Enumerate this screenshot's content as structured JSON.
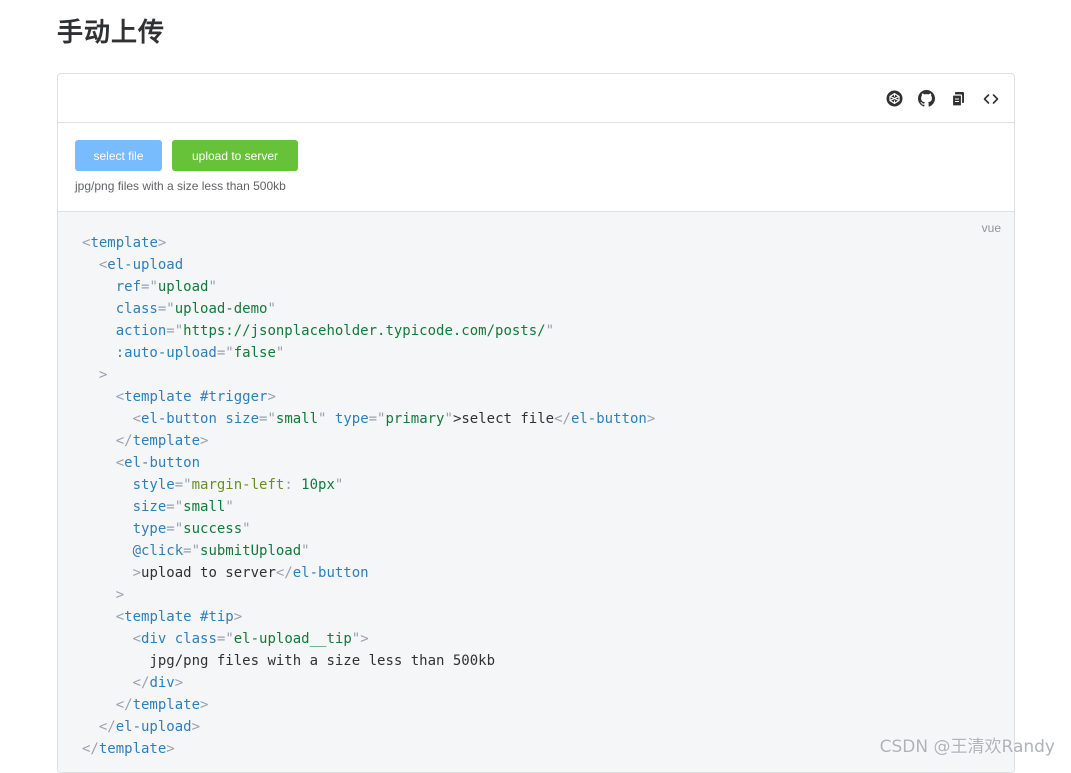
{
  "page": {
    "title": "手动上传"
  },
  "toolbar": {
    "icons": [
      {
        "name": "codepen-icon"
      },
      {
        "name": "github-icon"
      },
      {
        "name": "copy-icon"
      },
      {
        "name": "code-toggle-icon"
      }
    ]
  },
  "demo": {
    "select_button": "select file",
    "upload_button": "upload to server",
    "tip": "jpg/png files with a size less than 500kb",
    "colors": {
      "primary": "#79bbff",
      "success": "#67c23a"
    }
  },
  "code": {
    "language": "vue",
    "lines": [
      [
        [
          "p",
          "<"
        ],
        [
          "g",
          "template"
        ],
        [
          "p",
          ">"
        ]
      ],
      [
        [
          "w",
          "  "
        ],
        [
          "p",
          "<"
        ],
        [
          "g",
          "el-upload"
        ]
      ],
      [
        [
          "w",
          "    "
        ],
        [
          "a",
          "ref"
        ],
        [
          "p",
          "=\""
        ],
        [
          "s",
          "upload"
        ],
        [
          "p",
          "\""
        ]
      ],
      [
        [
          "w",
          "    "
        ],
        [
          "a",
          "class"
        ],
        [
          "p",
          "=\""
        ],
        [
          "s",
          "upload-demo"
        ],
        [
          "p",
          "\""
        ]
      ],
      [
        [
          "w",
          "    "
        ],
        [
          "a",
          "action"
        ],
        [
          "p",
          "=\""
        ],
        [
          "s",
          "https://jsonplaceholder.typicode.com/posts/"
        ],
        [
          "p",
          "\""
        ]
      ],
      [
        [
          "w",
          "    "
        ],
        [
          "a",
          ":auto-upload"
        ],
        [
          "p",
          "=\""
        ],
        [
          "s",
          "false"
        ],
        [
          "p",
          "\""
        ]
      ],
      [
        [
          "w",
          "  "
        ],
        [
          "p",
          ">"
        ]
      ],
      [
        [
          "w",
          "    "
        ],
        [
          "p",
          "<"
        ],
        [
          "g",
          "template #trigger"
        ],
        [
          "p",
          ">"
        ]
      ],
      [
        [
          "w",
          "      "
        ],
        [
          "p",
          "<"
        ],
        [
          "g",
          "el-button "
        ],
        [
          "a",
          "size"
        ],
        [
          "p",
          "=\""
        ],
        [
          "s",
          "small"
        ],
        [
          "p",
          "\" "
        ],
        [
          "a",
          "type"
        ],
        [
          "p",
          "=\""
        ],
        [
          "s",
          "primary"
        ],
        [
          "p",
          "\""
        ],
        [
          "t",
          ">select file"
        ],
        [
          "p",
          "</"
        ],
        [
          "g",
          "el-button"
        ],
        [
          "p",
          ">"
        ]
      ],
      [
        [
          "w",
          "    "
        ],
        [
          "p",
          "</"
        ],
        [
          "g",
          "template"
        ],
        [
          "p",
          ">"
        ]
      ],
      [
        [
          "w",
          "    "
        ],
        [
          "p",
          "<"
        ],
        [
          "g",
          "el-button"
        ]
      ],
      [
        [
          "w",
          "      "
        ],
        [
          "a",
          "style"
        ],
        [
          "p",
          "=\""
        ],
        [
          "c",
          "margin-left"
        ],
        [
          "p",
          ": "
        ],
        [
          "s",
          "10px"
        ],
        [
          "p",
          "\""
        ]
      ],
      [
        [
          "w",
          "      "
        ],
        [
          "a",
          "size"
        ],
        [
          "p",
          "=\""
        ],
        [
          "s",
          "small"
        ],
        [
          "p",
          "\""
        ]
      ],
      [
        [
          "w",
          "      "
        ],
        [
          "a",
          "type"
        ],
        [
          "p",
          "=\""
        ],
        [
          "s",
          "success"
        ],
        [
          "p",
          "\""
        ]
      ],
      [
        [
          "w",
          "      "
        ],
        [
          "a",
          "@click"
        ],
        [
          "p",
          "=\""
        ],
        [
          "s",
          "submitUpload"
        ],
        [
          "p",
          "\""
        ]
      ],
      [
        [
          "w",
          "      "
        ],
        [
          "p",
          ">"
        ],
        [
          "t",
          "upload to server"
        ],
        [
          "p",
          "</"
        ],
        [
          "g",
          "el-button"
        ]
      ],
      [
        [
          "w",
          "    "
        ],
        [
          "p",
          ">"
        ]
      ],
      [
        [
          "w",
          "    "
        ],
        [
          "p",
          "<"
        ],
        [
          "g",
          "template #tip"
        ],
        [
          "p",
          ">"
        ]
      ],
      [
        [
          "w",
          "      "
        ],
        [
          "p",
          "<"
        ],
        [
          "g",
          "div "
        ],
        [
          "a",
          "class"
        ],
        [
          "p",
          "=\""
        ],
        [
          "s",
          "el-upload__tip"
        ],
        [
          "p",
          "\">"
        ]
      ],
      [
        [
          "w",
          "        "
        ],
        [
          "t",
          "jpg/png files with a size less than 500kb"
        ]
      ],
      [
        [
          "w",
          "      "
        ],
        [
          "p",
          "</"
        ],
        [
          "g",
          "div"
        ],
        [
          "p",
          ">"
        ]
      ],
      [
        [
          "w",
          "    "
        ],
        [
          "p",
          "</"
        ],
        [
          "g",
          "template"
        ],
        [
          "p",
          ">"
        ]
      ],
      [
        [
          "w",
          "  "
        ],
        [
          "p",
          "</"
        ],
        [
          "g",
          "el-upload"
        ],
        [
          "p",
          ">"
        ]
      ],
      [
        [
          "p",
          "</"
        ],
        [
          "g",
          "template"
        ],
        [
          "p",
          ">"
        ]
      ]
    ]
  },
  "watermark": "CSDN @王清欢Randy"
}
